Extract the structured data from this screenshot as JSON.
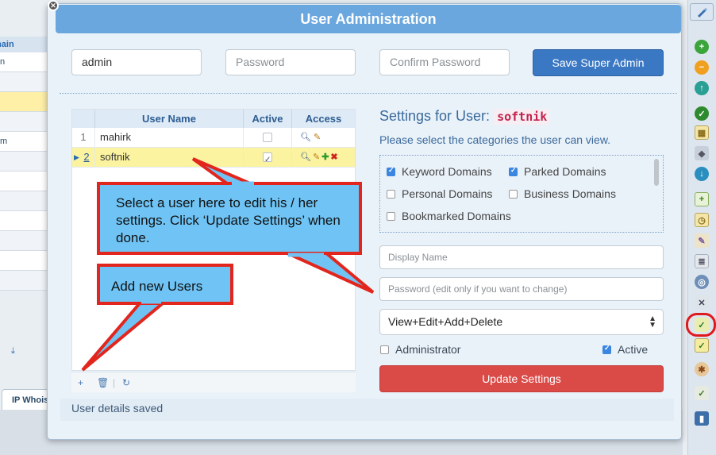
{
  "background": {
    "header": "main",
    "rows": [
      "n",
      "",
      "",
      "",
      "m",
      "",
      "",
      "",
      "",
      "",
      "",
      ""
    ],
    "tab": "IP Whois"
  },
  "dialog": {
    "title": "User Administration",
    "admin_value": "admin",
    "password_placeholder": "Password",
    "confirm_placeholder": "Confirm Password",
    "save_label": "Save Super Admin",
    "status": "User details saved"
  },
  "table": {
    "columns": [
      "User Name",
      "Active",
      "Access"
    ],
    "rows": [
      {
        "num": "1",
        "name": "mahirk",
        "active": false,
        "selected": false
      },
      {
        "num": "2",
        "name": "softnik",
        "active": true,
        "selected": true
      }
    ]
  },
  "settings": {
    "title": "Settings for User:",
    "user": "softnik",
    "subtitle": "Please select the categories the user can view.",
    "categories": [
      {
        "label": "Keyword Domains",
        "checked": true
      },
      {
        "label": "Parked Domains",
        "checked": true
      },
      {
        "label": "Personal Domains",
        "checked": false
      },
      {
        "label": "Business Domains",
        "checked": false
      },
      {
        "label": "Bookmarked Domains",
        "checked": false
      }
    ],
    "display_name_placeholder": "Display Name",
    "password_placeholder": "Password (edit only if you want to change)",
    "access_level": "View+Edit+Add+Delete",
    "administrator_label": "Administrator",
    "administrator_checked": false,
    "active_label": "Active",
    "active_checked": true,
    "update_label": "Update Settings"
  },
  "callouts": {
    "edit": "Select a user here to edit his / her settings. Click ‘Update Settings’ when done.",
    "add": "Add new Users"
  },
  "colors": {
    "title_bar": "#6aa7de",
    "save_button": "#3b78c4",
    "update_button": "#da4a47",
    "callout_fill": "#6fc4f5",
    "callout_border": "#e2261d"
  }
}
